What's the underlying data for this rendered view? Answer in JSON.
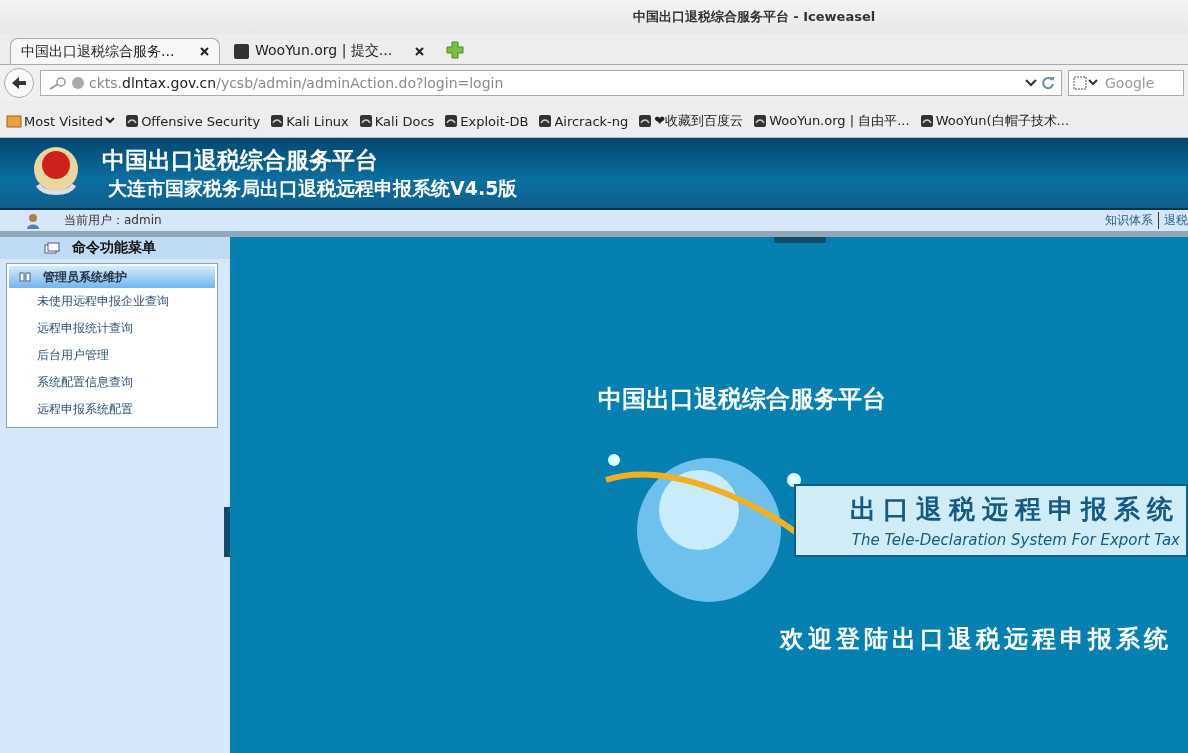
{
  "window": {
    "title": "中国出口退税综合服务平台 - Iceweasel"
  },
  "tabs": [
    {
      "label": "中国出口退税综合服务...",
      "selected": true
    },
    {
      "label": "WooYun.org | 提交...",
      "selected": false
    }
  ],
  "address_bar": {
    "host_prefix": "ckts.",
    "host": "dlntax.gov.cn",
    "path": "/ycsb/admin/adminAction.do?login=login"
  },
  "search": {
    "placeholder": "Google"
  },
  "bookmarks": [
    {
      "label": "Most Visited",
      "kind": "folder"
    },
    {
      "label": "Offensive Security",
      "kind": "link"
    },
    {
      "label": "Kali Linux",
      "kind": "link"
    },
    {
      "label": "Kali Docs",
      "kind": "link"
    },
    {
      "label": "Exploit-DB",
      "kind": "link"
    },
    {
      "label": "Aircrack-ng",
      "kind": "link"
    },
    {
      "label": "❤收藏到百度云",
      "kind": "link"
    },
    {
      "label": "WooYun.org | 自由平...",
      "kind": "link"
    },
    {
      "label": "WooYun(白帽子技术...",
      "kind": "link"
    }
  ],
  "banner": {
    "title": "中国出口退税综合服务平台",
    "subtitle": "大连市国家税务局出口退税远程申报系统V4.5版"
  },
  "user_bar": {
    "current_user": "当前用户：admin",
    "links": [
      "知识体系",
      "退税"
    ]
  },
  "sidebar": {
    "title": "命令功能菜单",
    "group": {
      "label": "管理员系统维护",
      "expanded": true,
      "items": [
        "未使用远程申报企业查询",
        "远程申报统计查询",
        "后台用户管理",
        "系统配置信息查询",
        "远程申报系统配置"
      ]
    }
  },
  "main": {
    "title": "中国出口退税综合服务平台",
    "system_name": "出口退税远程申报系统",
    "system_name_en": "The Tele-Declaration System For Export Tax",
    "welcome": "欢迎登陆出口退税远程申报系统"
  }
}
